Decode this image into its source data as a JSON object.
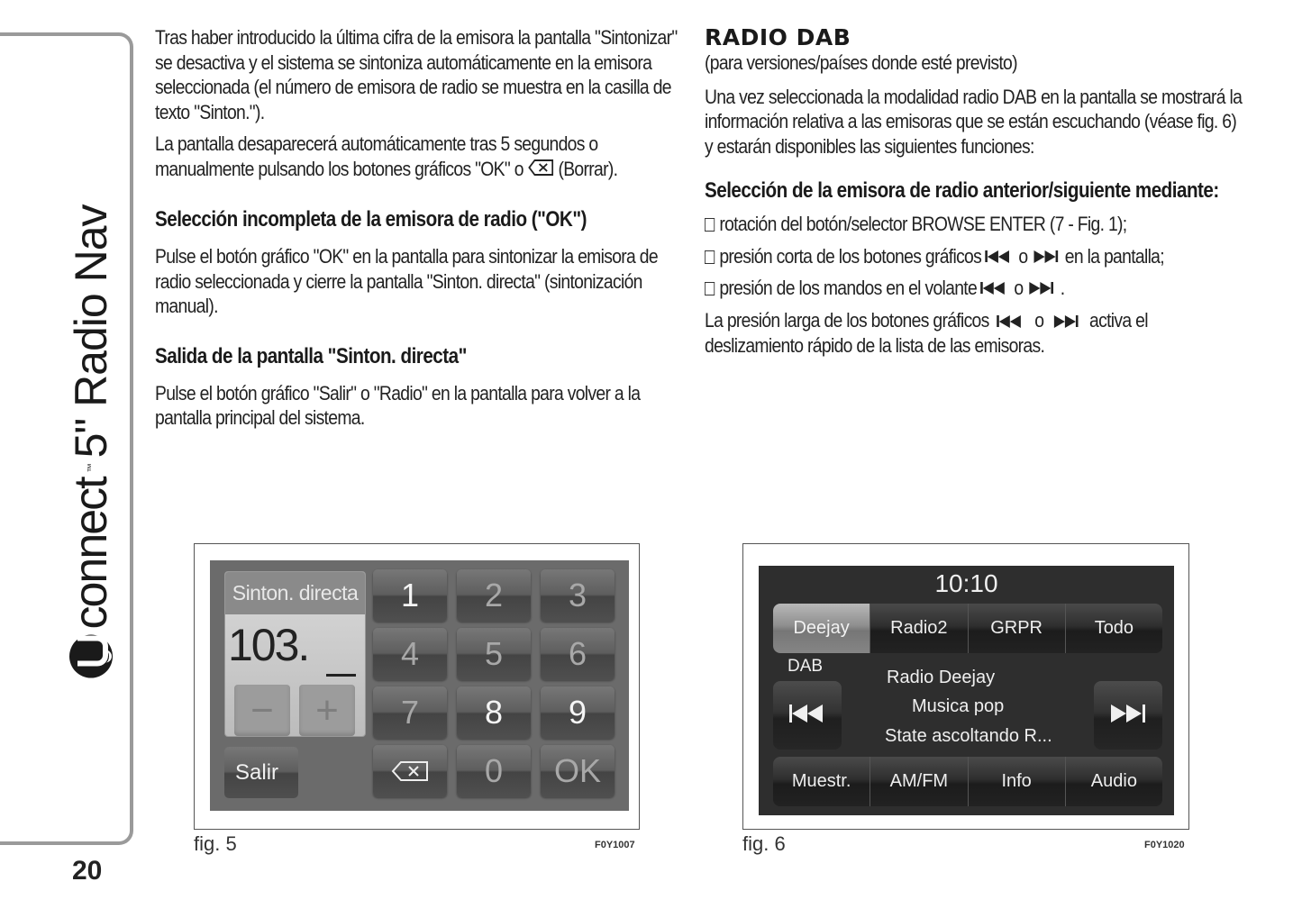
{
  "sidebar": {
    "brand": "connect",
    "brand_tm": "™",
    "section_title": "5\" Radio Nav",
    "page_number": "20"
  },
  "left_column": {
    "intro_paragraph": "Tras haber introducido la última cifra de la emisora la pantalla \"Sintonizar\" se desactiva y el sistema se sintoniza automáticamente en la emisora seleccionada (el número de emisora de radio se muestra en la casilla de texto \"Sinton.\").",
    "auto_close_paragraph_start": "La pantalla desaparecerá automáticamente tras 5 segundos o manualmente pulsando los botones gráficos \"OK\" o",
    "auto_close_paragraph_end": "(Borrar).",
    "section1_heading": "Selección incompleta de la emisora de radio (\"OK\")",
    "section1_text": "Pulse el botón gráfico \"OK\" en la pantalla para sintonizar la emisora de radio seleccionada y cierre la pantalla \"Sinton. directa\" (sintonización manual).",
    "section2_heading": "Salida de la pantalla \"Sinton. directa\"",
    "section2_text": "Pulse el botón gráfico \"Salir\" o \"Radio\" en la pantalla para volver a la pantalla principal del sistema."
  },
  "right_column": {
    "title": "RADIO DAB",
    "subtitle": "(para versiones/países donde esté previsto)",
    "intro": "Una vez seleccionada la modalidad radio DAB en la pantalla se mostrará la información relativa a las emisoras que se están escuchando (véase fig. 6) y estarán disponibles las siguientes funciones:",
    "heading": "Selección de la emisora de radio anterior/siguiente mediante:",
    "bullets": [
      {
        "text_start": "rotación del botón/selector BROWSE ENTER (7 - Fig. 1);",
        "text_end": ""
      },
      {
        "text_start": "presión corta de los botones gráficos",
        "connector": "o",
        "text_end": "en la pantalla;"
      },
      {
        "text_start": "presión de los mandos en el volante",
        "connector": "o",
        "text_end": "."
      }
    ],
    "long_press_start": "La presión larga de los botones gráficos",
    "long_press_connector": "o",
    "long_press_end": "activa el deslizamiento rápido de la lista de las emisoras."
  },
  "figure5": {
    "label": "fig. 5",
    "code": "F0Y1007",
    "screen": {
      "title": "Sinton. directa",
      "value": "103.",
      "cursor": "_",
      "minus_label": "−",
      "plus_label": "+",
      "exit_label": "Salir",
      "keys": [
        "1",
        "2",
        "3",
        "4",
        "5",
        "6",
        "7",
        "8",
        "9",
        "backspace-icon",
        "0",
        "OK"
      ],
      "key_labels": {
        "k1": "1",
        "k2": "2",
        "k3": "3",
        "k4": "4",
        "k5": "5",
        "k6": "6",
        "k7": "7",
        "k8": "8",
        "k9": "9",
        "k0": "0",
        "ok": "OK"
      }
    }
  },
  "figure6": {
    "label": "fig. 6",
    "code": "F0Y1020",
    "screen": {
      "clock": "10:10",
      "presets": [
        "Deejay",
        "Radio2",
        "GRPR",
        "Todo"
      ],
      "active_preset": "Deejay",
      "band": "DAB",
      "station_name": "Radio Deejay",
      "genre": "Musica pop",
      "radiotext": "State ascoltando R...",
      "bottom_menu": [
        "Muestr.",
        "AM/FM",
        "Info",
        "Audio"
      ]
    }
  }
}
